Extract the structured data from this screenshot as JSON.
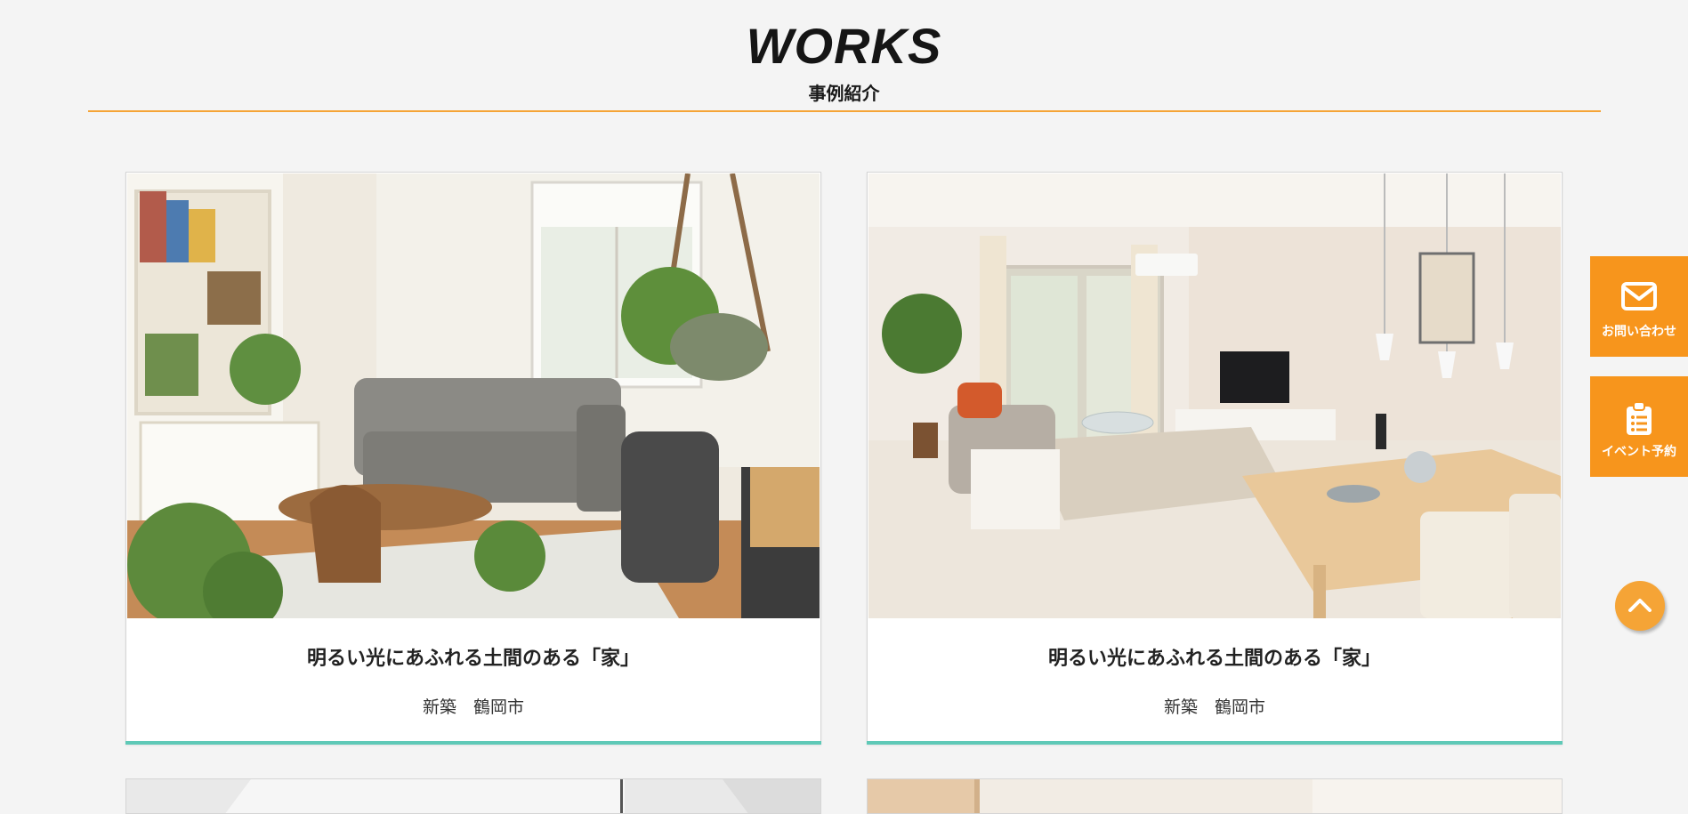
{
  "header": {
    "title": "WORKS",
    "subtitle": "事例紹介",
    "accent_color": "#f5a436"
  },
  "works": [
    {
      "title": "明るい光にあふれる土間のある「家」",
      "meta": "新築　鶴岡市",
      "image": "living-room-with-plants-photo"
    },
    {
      "title": "明るい光にあふれる土間のある「家」",
      "meta": "新築　鶴岡市",
      "image": "bright-living-dining-room-photo"
    }
  ],
  "side_buttons": {
    "contact": {
      "label": "お問い合わせ",
      "icon": "envelope-icon"
    },
    "event": {
      "label": "イベント予約",
      "icon": "clipboard-list-icon"
    }
  },
  "to_top": {
    "icon": "chevron-up-icon"
  },
  "colors": {
    "card_underline": "#5fc9b7",
    "side_button": "#f7951c",
    "background": "#f4f4f4"
  }
}
